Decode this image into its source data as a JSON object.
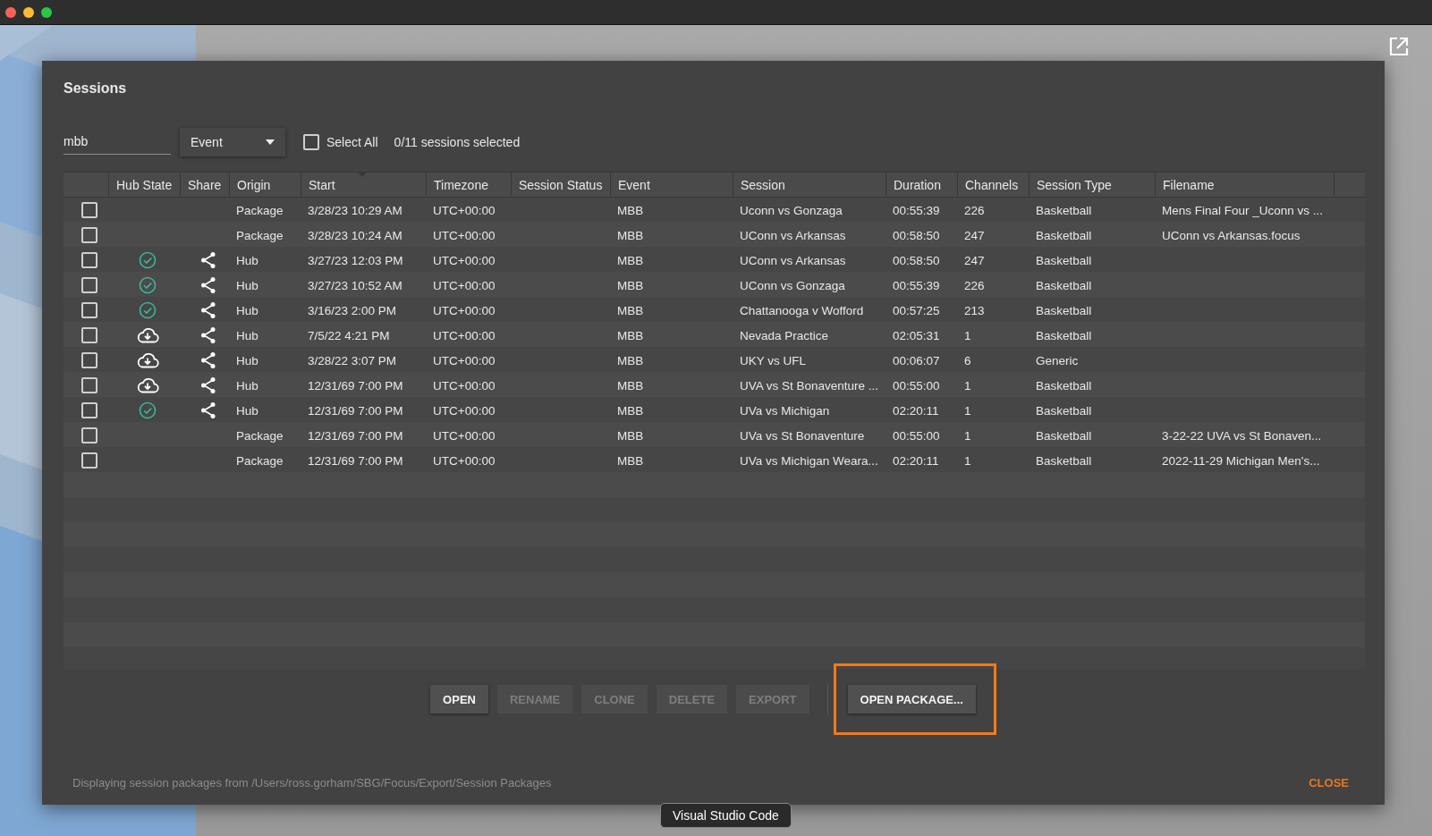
{
  "dialog": {
    "title": "Sessions",
    "filter": {
      "value": "mbb"
    },
    "dropdown": {
      "value": "Event"
    },
    "select_all": {
      "label": "Select All",
      "checked": false
    },
    "selection_count": "0/11 sessions selected",
    "table": {
      "columns": [
        {},
        {
          "label": "Hub State"
        },
        {
          "label": "Share"
        },
        {
          "label": "Origin"
        },
        {
          "label": "Start",
          "sorted": true
        },
        {
          "label": "Timezone"
        },
        {
          "label": "Session Status"
        },
        {
          "label": "Event"
        },
        {
          "label": "Session"
        },
        {
          "label": "Duration"
        },
        {
          "label": "Channels"
        },
        {
          "label": "Session Type"
        },
        {
          "label": "Filename"
        },
        {}
      ],
      "rows": [
        {
          "checked": false,
          "kind": "package",
          "share": false,
          "origin": "Package",
          "start": "3/28/23 10:29 AM",
          "timezone": "UTC+00:00",
          "event": "MBB",
          "session": "Uconn vs Gonzaga",
          "duration": "00:55:39",
          "channels": "226",
          "session_type": "Basketball",
          "filename": "Mens Final Four _Uconn vs ..."
        },
        {
          "checked": false,
          "kind": "package",
          "share": false,
          "origin": "Package",
          "start": "3/28/23 10:24 AM",
          "timezone": "UTC+00:00",
          "event": "MBB",
          "session": "UConn vs Arkansas",
          "duration": "00:58:50",
          "channels": "247",
          "session_type": "Basketball",
          "filename": "UConn vs Arkansas.focus"
        },
        {
          "checked": false,
          "kind": "synced",
          "share": true,
          "origin": "Hub",
          "start": "3/27/23 12:03 PM",
          "timezone": "UTC+00:00",
          "event": "MBB",
          "session": "UConn vs Arkansas",
          "duration": "00:58:50",
          "channels": "247",
          "session_type": "Basketball"
        },
        {
          "checked": false,
          "kind": "synced",
          "share": true,
          "origin": "Hub",
          "start": "3/27/23 10:52 AM",
          "timezone": "UTC+00:00",
          "event": "MBB",
          "session": "UConn vs Gonzaga",
          "duration": "00:55:39",
          "channels": "226",
          "session_type": "Basketball"
        },
        {
          "checked": false,
          "kind": "synced",
          "share": true,
          "origin": "Hub",
          "start": "3/16/23 2:00 PM",
          "timezone": "UTC+00:00",
          "event": "MBB",
          "session": "Chattanooga v Wofford",
          "duration": "00:57:25",
          "channels": "213",
          "session_type": "Basketball"
        },
        {
          "checked": false,
          "kind": "cloud",
          "share": true,
          "origin": "Hub",
          "start": "7/5/22 4:21 PM",
          "timezone": "UTC+00:00",
          "event": "MBB",
          "session": "Nevada Practice",
          "duration": "02:05:31",
          "channels": "1",
          "session_type": "Basketball"
        },
        {
          "checked": false,
          "kind": "cloud",
          "share": true,
          "origin": "Hub",
          "start": "3/28/22 3:07 PM",
          "timezone": "UTC+00:00",
          "event": "MBB",
          "session": "UKY vs UFL",
          "duration": "00:06:07",
          "channels": "6",
          "session_type": "Generic"
        },
        {
          "checked": false,
          "kind": "cloud",
          "share": true,
          "origin": "Hub",
          "start": "12/31/69 7:00 PM",
          "timezone": "UTC+00:00",
          "event": "MBB",
          "session": "UVA vs St Bonaventure ...",
          "duration": "00:55:00",
          "channels": "1",
          "session_type": "Basketball"
        },
        {
          "checked": false,
          "kind": "synced",
          "share": true,
          "origin": "Hub",
          "start": "12/31/69 7:00 PM",
          "timezone": "UTC+00:00",
          "event": "MBB",
          "session": "UVa vs Michigan",
          "duration": "02:20:11",
          "channels": "1",
          "session_type": "Basketball"
        },
        {
          "checked": false,
          "kind": "package",
          "share": false,
          "origin": "Package",
          "start": "12/31/69 7:00 PM",
          "timezone": "UTC+00:00",
          "event": "MBB",
          "session": "UVa vs St Bonaventure",
          "duration": "00:55:00",
          "channels": "1",
          "session_type": "Basketball",
          "filename": "3-22-22 UVA vs St Bonaven..."
        },
        {
          "checked": false,
          "kind": "package",
          "share": false,
          "origin": "Package",
          "start": "12/31/69 7:00 PM",
          "timezone": "UTC+00:00",
          "event": "MBB",
          "session": "UVa vs Michigan Weara...",
          "duration": "02:20:11",
          "channels": "1",
          "session_type": "Basketball",
          "filename": "2022-11-29 Michigan Men's..."
        }
      ]
    },
    "buttons": [
      {
        "label": "OPEN",
        "disabled": false
      },
      {
        "label": "RENAME",
        "disabled": true
      },
      {
        "label": "CLONE",
        "disabled": true
      },
      {
        "label": "DELETE",
        "disabled": true
      },
      {
        "label": "EXPORT",
        "disabled": true
      }
    ],
    "package_button": {
      "label": "OPEN PACKAGE...",
      "disabled": false,
      "highlighted": true
    },
    "status": "Displaying session packages from /Users/ross.gorham/SBG/Focus/Export/Session Packages",
    "close": "CLOSE"
  },
  "tooltip": "Visual Studio Code"
}
